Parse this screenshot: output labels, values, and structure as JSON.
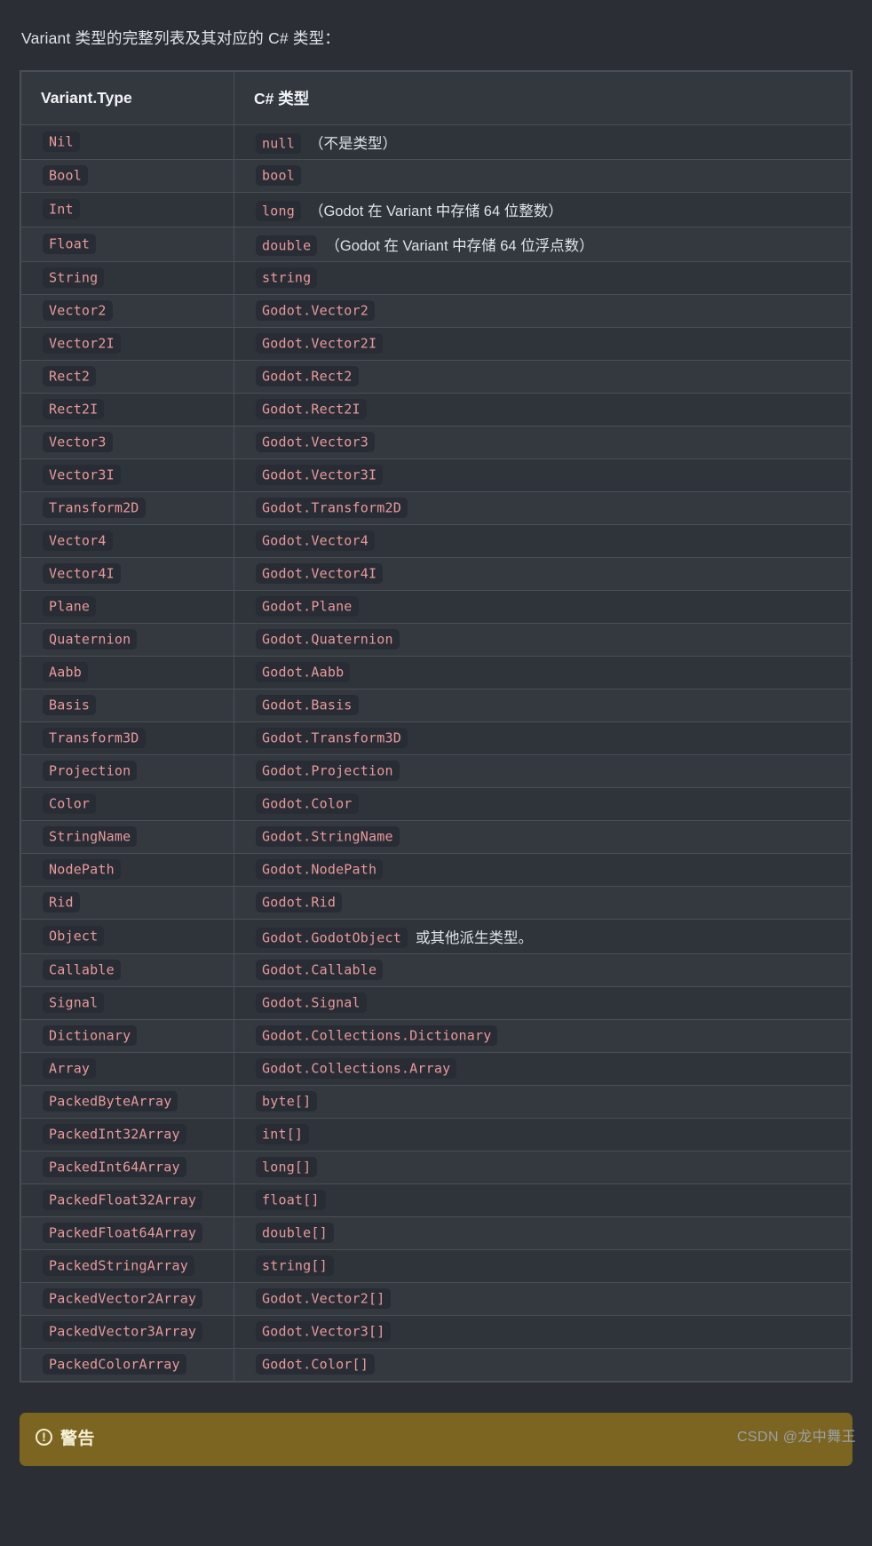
{
  "intro": "Variant 类型的完整列表及其对应的 C# 类型：",
  "table": {
    "headers": [
      "Variant.Type",
      "C# 类型"
    ],
    "rows": [
      {
        "variant": "Nil",
        "csharp": "null",
        "note": "（不是类型）"
      },
      {
        "variant": "Bool",
        "csharp": "bool",
        "note": ""
      },
      {
        "variant": "Int",
        "csharp": "long",
        "note": "（Godot 在 Variant 中存储 64 位整数）"
      },
      {
        "variant": "Float",
        "csharp": "double",
        "note": "（Godot 在 Variant 中存储 64 位浮点数）"
      },
      {
        "variant": "String",
        "csharp": "string",
        "note": ""
      },
      {
        "variant": "Vector2",
        "csharp": "Godot.Vector2",
        "note": ""
      },
      {
        "variant": "Vector2I",
        "csharp": "Godot.Vector2I",
        "note": ""
      },
      {
        "variant": "Rect2",
        "csharp": "Godot.Rect2",
        "note": ""
      },
      {
        "variant": "Rect2I",
        "csharp": "Godot.Rect2I",
        "note": ""
      },
      {
        "variant": "Vector3",
        "csharp": "Godot.Vector3",
        "note": ""
      },
      {
        "variant": "Vector3I",
        "csharp": "Godot.Vector3I",
        "note": ""
      },
      {
        "variant": "Transform2D",
        "csharp": "Godot.Transform2D",
        "note": ""
      },
      {
        "variant": "Vector4",
        "csharp": "Godot.Vector4",
        "note": ""
      },
      {
        "variant": "Vector4I",
        "csharp": "Godot.Vector4I",
        "note": ""
      },
      {
        "variant": "Plane",
        "csharp": "Godot.Plane",
        "note": ""
      },
      {
        "variant": "Quaternion",
        "csharp": "Godot.Quaternion",
        "note": ""
      },
      {
        "variant": "Aabb",
        "csharp": "Godot.Aabb",
        "note": ""
      },
      {
        "variant": "Basis",
        "csharp": "Godot.Basis",
        "note": ""
      },
      {
        "variant": "Transform3D",
        "csharp": "Godot.Transform3D",
        "note": ""
      },
      {
        "variant": "Projection",
        "csharp": "Godot.Projection",
        "note": ""
      },
      {
        "variant": "Color",
        "csharp": "Godot.Color",
        "note": ""
      },
      {
        "variant": "StringName",
        "csharp": "Godot.StringName",
        "note": ""
      },
      {
        "variant": "NodePath",
        "csharp": "Godot.NodePath",
        "note": ""
      },
      {
        "variant": "Rid",
        "csharp": "Godot.Rid",
        "note": ""
      },
      {
        "variant": "Object",
        "csharp": "Godot.GodotObject",
        "note": "或其他派生类型。"
      },
      {
        "variant": "Callable",
        "csharp": "Godot.Callable",
        "note": ""
      },
      {
        "variant": "Signal",
        "csharp": "Godot.Signal",
        "note": ""
      },
      {
        "variant": "Dictionary",
        "csharp": "Godot.Collections.Dictionary",
        "note": ""
      },
      {
        "variant": "Array",
        "csharp": "Godot.Collections.Array",
        "note": ""
      },
      {
        "variant": "PackedByteArray",
        "csharp": "byte[]",
        "note": ""
      },
      {
        "variant": "PackedInt32Array",
        "csharp": "int[]",
        "note": ""
      },
      {
        "variant": "PackedInt64Array",
        "csharp": "long[]",
        "note": ""
      },
      {
        "variant": "PackedFloat32Array",
        "csharp": "float[]",
        "note": ""
      },
      {
        "variant": "PackedFloat64Array",
        "csharp": "double[]",
        "note": ""
      },
      {
        "variant": "PackedStringArray",
        "csharp": "string[]",
        "note": ""
      },
      {
        "variant": "PackedVector2Array",
        "csharp": "Godot.Vector2[]",
        "note": ""
      },
      {
        "variant": "PackedVector3Array",
        "csharp": "Godot.Vector3[]",
        "note": ""
      },
      {
        "variant": "PackedColorArray",
        "csharp": "Godot.Color[]",
        "note": ""
      }
    ]
  },
  "warning": {
    "icon": "exclamation-circle-icon",
    "icon_glyph": "!",
    "title": "警告"
  },
  "watermark": "CSDN @龙中舞王",
  "colors": {
    "page_background": "#2b2f35",
    "table_background": "#2f343a",
    "table_row_alt": "#343940",
    "table_border": "#4a4f57",
    "code_background": "#282c34",
    "code_text": "#e89a9a",
    "body_text": "#dfe3e8",
    "warning_background": "#7b6520",
    "warning_text": "#f7f1d8"
  }
}
